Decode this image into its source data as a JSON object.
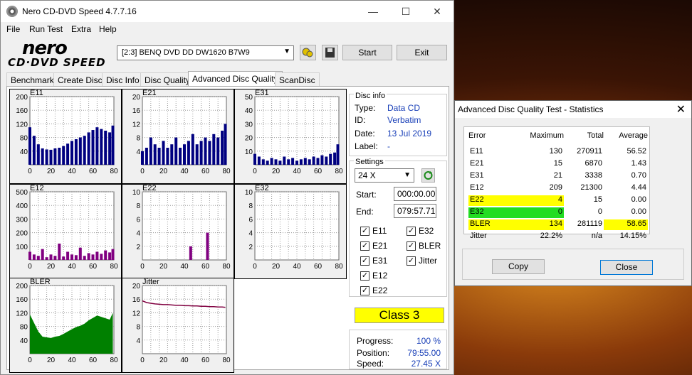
{
  "window": {
    "title": "Nero CD-DVD Speed 4.7.7.16",
    "minimize": "—",
    "maximize": "☐",
    "close": "✕"
  },
  "menu": [
    "File",
    "Run Test",
    "Extra",
    "Help"
  ],
  "logo": {
    "top": "nero",
    "bottom": "CD·DVD SPEED"
  },
  "toolbar": {
    "drive": "[2:3]   BENQ DVD DD DW1620 B7W9",
    "start": "Start",
    "exit": "Exit"
  },
  "tabs": [
    "Benchmark",
    "Create Disc",
    "Disc Info",
    "Disc Quality",
    "Advanced Disc Quality",
    "ScanDisc"
  ],
  "active_tab": "Advanced Disc Quality",
  "disc_info": {
    "title": "Disc info",
    "type_k": "Type:",
    "type_v": "Data CD",
    "id_k": "ID:",
    "id_v": "Verbatim",
    "date_k": "Date:",
    "date_v": "13 Jul 2019",
    "label_k": "Label:",
    "label_v": "-"
  },
  "settings": {
    "title": "Settings",
    "speed": "24 X",
    "start_k": "Start:",
    "start_v": "000:00.00",
    "end_k": "End:",
    "end_v": "079:57.71"
  },
  "checkboxes": [
    {
      "label": "E11",
      "checked": true
    },
    {
      "label": "E32",
      "checked": true
    },
    {
      "label": "E21",
      "checked": true
    },
    {
      "label": "BLER",
      "checked": true
    },
    {
      "label": "E31",
      "checked": true
    },
    {
      "label": "Jitter",
      "checked": true
    },
    {
      "label": "E12",
      "checked": true
    },
    {
      "label": "E22",
      "checked": true
    }
  ],
  "class_label": "Class 3",
  "progress": {
    "progress_k": "Progress:",
    "progress_v": "100 %",
    "position_k": "Position:",
    "position_v": "79:55.00",
    "speed_k": "Speed:",
    "speed_v": "27.45 X"
  },
  "stats": {
    "title": "Advanced Disc Quality Test - Statistics",
    "headers": [
      "Error",
      "Maximum",
      "Total",
      "Average"
    ],
    "rows": [
      {
        "error": "E11",
        "max": "130",
        "total": "270911",
        "avg": "56.52"
      },
      {
        "error": "E21",
        "max": "15",
        "total": "6870",
        "avg": "1.43"
      },
      {
        "error": "E31",
        "max": "21",
        "total": "3338",
        "avg": "0.70"
      },
      {
        "error": "E12",
        "max": "209",
        "total": "21300",
        "avg": "4.44"
      },
      {
        "error": "E22",
        "max": "4",
        "total": "15",
        "avg": "0.00"
      },
      {
        "error": "E32",
        "max": "0",
        "total": "0",
        "avg": "0.00"
      },
      {
        "error": "BLER",
        "max": "134",
        "total": "281119",
        "avg": "58.65"
      },
      {
        "error": "Jitter",
        "max": "22.2%",
        "total": "n/a",
        "avg": "14.15%"
      }
    ],
    "copy": "Copy",
    "close": "Close"
  },
  "chart_data": [
    {
      "type": "bar",
      "title": "E11",
      "yticks": [
        200,
        160,
        120,
        80,
        40
      ],
      "xticks": [
        0,
        20,
        40,
        60,
        80
      ],
      "ylim": [
        0,
        200
      ],
      "xlim": [
        0,
        80
      ],
      "color": "#000080",
      "x": [
        0,
        4,
        8,
        12,
        16,
        20,
        24,
        28,
        32,
        36,
        40,
        44,
        48,
        52,
        56,
        60,
        64,
        68,
        72,
        76,
        79
      ],
      "values": [
        110,
        85,
        60,
        48,
        45,
        44,
        48,
        50,
        55,
        62,
        70,
        75,
        80,
        85,
        95,
        102,
        110,
        105,
        100,
        95,
        115
      ]
    },
    {
      "type": "bar",
      "title": "E21",
      "yticks": [
        20,
        16,
        12,
        8,
        4
      ],
      "xticks": [
        0,
        20,
        40,
        60,
        80
      ],
      "ylim": [
        0,
        20
      ],
      "xlim": [
        0,
        80
      ],
      "color": "#000080",
      "x": [
        0,
        4,
        8,
        12,
        16,
        20,
        24,
        28,
        32,
        36,
        40,
        44,
        48,
        52,
        56,
        60,
        64,
        68,
        72,
        76,
        79
      ],
      "values": [
        4,
        5,
        8,
        6,
        5,
        7,
        5,
        6,
        8,
        5,
        6,
        7,
        9,
        6,
        7,
        8,
        7,
        9,
        8,
        10,
        12
      ]
    },
    {
      "type": "bar",
      "title": "E31",
      "yticks": [
        50,
        40,
        30,
        20,
        10
      ],
      "xticks": [
        0,
        20,
        40,
        60,
        80
      ],
      "ylim": [
        0,
        50
      ],
      "xlim": [
        0,
        80
      ],
      "color": "#000080",
      "x": [
        0,
        4,
        8,
        12,
        16,
        20,
        24,
        28,
        32,
        36,
        40,
        44,
        48,
        52,
        56,
        60,
        64,
        68,
        72,
        76,
        79
      ],
      "values": [
        8,
        6,
        4,
        3,
        5,
        4,
        3,
        6,
        4,
        5,
        3,
        4,
        5,
        4,
        6,
        5,
        7,
        6,
        8,
        9,
        15
      ]
    },
    {
      "type": "bar",
      "title": "E12",
      "yticks": [
        500,
        400,
        300,
        200,
        100
      ],
      "xticks": [
        0,
        20,
        40,
        60,
        80
      ],
      "ylim": [
        0,
        500
      ],
      "xlim": [
        0,
        80
      ],
      "color": "#800080",
      "x": [
        0,
        4,
        8,
        12,
        16,
        20,
        24,
        28,
        32,
        36,
        40,
        44,
        48,
        52,
        56,
        60,
        64,
        68,
        72,
        76,
        79
      ],
      "values": [
        60,
        40,
        30,
        80,
        20,
        40,
        30,
        120,
        25,
        60,
        40,
        35,
        90,
        30,
        50,
        40,
        60,
        45,
        70,
        55,
        80
      ]
    },
    {
      "type": "bar",
      "title": "E22",
      "yticks": [
        10,
        8,
        6,
        4,
        2
      ],
      "xticks": [
        0,
        20,
        40,
        60,
        80
      ],
      "ylim": [
        0,
        10
      ],
      "xlim": [
        0,
        80
      ],
      "color": "#800080",
      "x": [
        46,
        62
      ],
      "values": [
        2,
        4
      ]
    },
    {
      "type": "bar",
      "title": "E32",
      "yticks": [
        10,
        8,
        6,
        4,
        2
      ],
      "xticks": [
        0,
        20,
        40,
        60,
        80
      ],
      "ylim": [
        0,
        10
      ],
      "xlim": [
        0,
        80
      ],
      "color": "#800080",
      "x": [],
      "values": []
    },
    {
      "type": "area",
      "title": "BLER",
      "yticks": [
        200,
        160,
        120,
        80,
        40
      ],
      "xticks": [
        0,
        20,
        40,
        60,
        80
      ],
      "ylim": [
        0,
        200
      ],
      "xlim": [
        0,
        80
      ],
      "color": "#008000",
      "x": [
        0,
        4,
        8,
        12,
        16,
        20,
        24,
        28,
        32,
        36,
        40,
        44,
        48,
        52,
        56,
        60,
        64,
        68,
        72,
        76,
        79
      ],
      "values": [
        115,
        90,
        65,
        50,
        48,
        46,
        50,
        52,
        58,
        65,
        72,
        78,
        82,
        88,
        98,
        105,
        112,
        108,
        104,
        100,
        120
      ]
    },
    {
      "type": "line",
      "title": "Jitter",
      "yticks": [
        20,
        16,
        12,
        8,
        4
      ],
      "xticks": [
        0,
        20,
        40,
        60,
        80
      ],
      "ylim": [
        0,
        20
      ],
      "xlim": [
        0,
        80
      ],
      "color": "#800040",
      "x": [
        0,
        4,
        8,
        12,
        16,
        20,
        24,
        28,
        32,
        36,
        40,
        44,
        48,
        52,
        56,
        60,
        64,
        68,
        72,
        76,
        79
      ],
      "values": [
        15.5,
        15,
        14.8,
        14.6,
        14.5,
        14.4,
        14.4,
        14.3,
        14.2,
        14.2,
        14.1,
        14.1,
        14.0,
        14.0,
        13.9,
        13.9,
        13.8,
        13.8,
        13.7,
        13.7,
        13.6
      ]
    }
  ]
}
